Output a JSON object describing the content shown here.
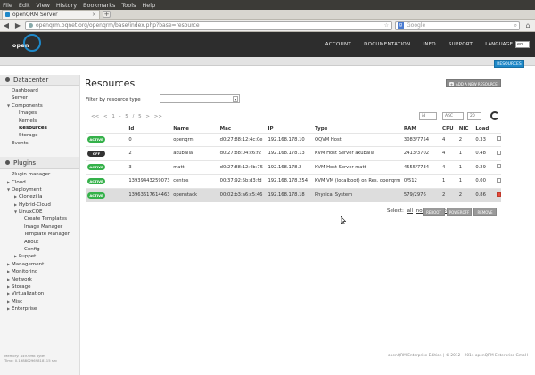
{
  "browser": {
    "menu": [
      "File",
      "Edit",
      "View",
      "History",
      "Bookmarks",
      "Tools",
      "Help"
    ],
    "tab_title": "openQRM Server",
    "url": "openqrm.oqnet.org/openqrm/base/index.php?base=resource",
    "search_placeholder": "Google"
  },
  "header": {
    "logo_text": "open",
    "nav": [
      "ACCOUNT",
      "DOCUMENTATION",
      "INFO",
      "SUPPORT"
    ],
    "language_label": "LANGUAGE",
    "language_value": "en",
    "resources_button": "RESOURCES"
  },
  "sidebar": {
    "datacenter_title": "Datacenter",
    "datacenter_items": [
      {
        "label": "Dashboard",
        "level": 0,
        "tri": ""
      },
      {
        "label": "Server",
        "level": 0,
        "tri": ""
      },
      {
        "label": "Components",
        "level": 0,
        "tri": "open"
      },
      {
        "label": "Images",
        "level": 1,
        "tri": ""
      },
      {
        "label": "Kernels",
        "level": 1,
        "tri": ""
      },
      {
        "label": "Resources",
        "level": 1,
        "tri": "",
        "selected": true
      },
      {
        "label": "Storage",
        "level": 1,
        "tri": ""
      },
      {
        "label": "Events",
        "level": 0,
        "tri": ""
      }
    ],
    "plugins_title": "Plugins",
    "plugin_items": [
      {
        "label": "Plugin manager",
        "level": 0,
        "tri": ""
      },
      {
        "label": "Cloud",
        "level": 0,
        "tri": "closed"
      },
      {
        "label": "Deployment",
        "level": 0,
        "tri": "open"
      },
      {
        "label": "Clonezilla",
        "level": 1,
        "tri": "closed"
      },
      {
        "label": "Hybrid-Cloud",
        "level": 1,
        "tri": "closed"
      },
      {
        "label": "LinuxCOE",
        "level": 1,
        "tri": "open"
      },
      {
        "label": "Create Templates",
        "level": 2,
        "tri": ""
      },
      {
        "label": "Image Manager",
        "level": 2,
        "tri": ""
      },
      {
        "label": "Template Manager",
        "level": 2,
        "tri": ""
      },
      {
        "label": "About",
        "level": 2,
        "tri": ""
      },
      {
        "label": "Config",
        "level": 2,
        "tri": ""
      },
      {
        "label": "Puppet",
        "level": 1,
        "tri": "closed"
      },
      {
        "label": "Management",
        "level": 0,
        "tri": "closed"
      },
      {
        "label": "Monitoring",
        "level": 0,
        "tri": "closed"
      },
      {
        "label": "Network",
        "level": 0,
        "tri": "closed"
      },
      {
        "label": "Storage",
        "level": 0,
        "tri": "closed"
      },
      {
        "label": "Virtualization",
        "level": 0,
        "tri": "closed"
      },
      {
        "label": "Misc",
        "level": 0,
        "tri": "closed"
      },
      {
        "label": "Enterprise",
        "level": 0,
        "tri": "closed"
      }
    ],
    "footer_line1": "Memory: 4497998 bytes",
    "footer_line2": "Time: 0.198802969818115 sec"
  },
  "main": {
    "title": "Resources",
    "add_button": "ADD A NEW RESOURCE",
    "filter_label": "Filter by resource type",
    "pager": {
      "first": "<<",
      "prev": "<",
      "info": "1 - 5 / 5",
      "next": ">",
      "last": ">>"
    },
    "controls": {
      "sort": "id",
      "order": "ASC",
      "limit": "20"
    },
    "columns": [
      "",
      "Id",
      "Name",
      "Mac",
      "IP",
      "Type",
      "RAM",
      "CPU",
      "NIC",
      "Load",
      ""
    ],
    "rows": [
      {
        "state": "ACTIVE",
        "id": "0",
        "name": "openqrm",
        "mac": "d0:27:88:12:4c:0e",
        "ip": "192.168.178.10",
        "type": "OQVM Host",
        "ram": "3083/7754",
        "cpu": "4",
        "nic": "2",
        "load": "0.33",
        "checked": false
      },
      {
        "state": "OFF",
        "id": "2",
        "name": "akuballa",
        "mac": "d0:27:88:04:c6:f2",
        "ip": "192.168.178.13",
        "type": "KVM Host Server akuballa",
        "ram": "2413/3702",
        "cpu": "4",
        "nic": "1",
        "load": "0.48",
        "checked": false
      },
      {
        "state": "ACTIVE",
        "id": "3",
        "name": "matt",
        "mac": "d0:27:88:12:4b:75",
        "ip": "192.168.178.2",
        "type": "KVM Host Server matt",
        "ram": "4555/7734",
        "cpu": "4",
        "nic": "1",
        "load": "0.29",
        "checked": false
      },
      {
        "state": "ACTIVE",
        "id": "13939443259073",
        "name": "centos",
        "mac": "00:37:92:5b:d3:fd",
        "ip": "192.168.178.254",
        "type": "KVM VM (localboot) on Res. openqrm",
        "ram": "0/512",
        "cpu": "1",
        "nic": "1",
        "load": "0.00",
        "checked": false
      },
      {
        "state": "ACTIVE",
        "id": "13963617614463",
        "name": "openstack",
        "mac": "00:02:b3:a6:c5:46",
        "ip": "192.168.178.18",
        "type": "Physical System",
        "ram": "579/2976",
        "cpu": "2",
        "nic": "2",
        "load": "0.86",
        "checked": true
      }
    ],
    "select_label": "Select:",
    "select_all": "all",
    "select_none": "none",
    "select_inverted": "inverted",
    "actions": [
      "REBOOT",
      "POWEROFF",
      "REMOVE"
    ]
  },
  "footer": {
    "copyright": "openQRM Enterprise Edition | © 2012 - 2014 openQRM Enterprise GmbH"
  }
}
